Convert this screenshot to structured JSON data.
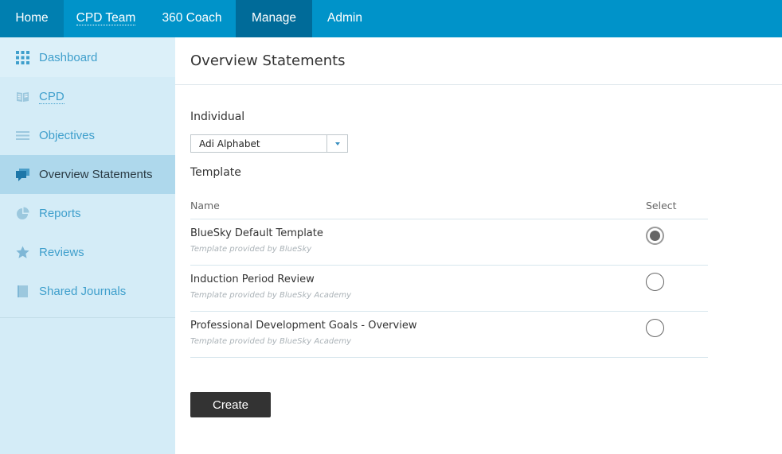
{
  "topnav": {
    "home": "Home",
    "cpd_team": "CPD Team",
    "coach": "360 Coach",
    "manage": "Manage",
    "admin": "Admin"
  },
  "sidebar": {
    "items": [
      {
        "label": "Dashboard",
        "icon": "grid-icon"
      },
      {
        "label": "CPD",
        "icon": "book-icon"
      },
      {
        "label": "Objectives",
        "icon": "list-icon"
      },
      {
        "label": "Overview Statements",
        "icon": "speech-bubbles-icon",
        "active": true
      },
      {
        "label": "Reports",
        "icon": "pie-chart-icon"
      },
      {
        "label": "Reviews",
        "icon": "star-icon"
      },
      {
        "label": "Shared Journals",
        "icon": "journal-icon"
      }
    ]
  },
  "main": {
    "title": "Overview Statements",
    "individual_label": "Individual",
    "individual_value": "Adi Alphabet",
    "template_label": "Template",
    "table": {
      "col_name": "Name",
      "col_select": "Select",
      "rows": [
        {
          "name": "BlueSky Default Template",
          "provider": "Template provided by BlueSky",
          "selected": true
        },
        {
          "name": "Induction Period Review",
          "provider": "Template provided by BlueSky Academy",
          "selected": false
        },
        {
          "name": "Professional Development Goals - Overview",
          "provider": "Template provided by BlueSky Academy",
          "selected": false
        }
      ]
    },
    "create_label": "Create"
  },
  "colors": {
    "nav_bg": "#0093c9",
    "nav_active": "#006b99",
    "sidebar_bg": "#d4ecf7",
    "sidebar_active": "#aed8ec",
    "link_blue": "#3f9fcc",
    "button_dark": "#333333"
  }
}
